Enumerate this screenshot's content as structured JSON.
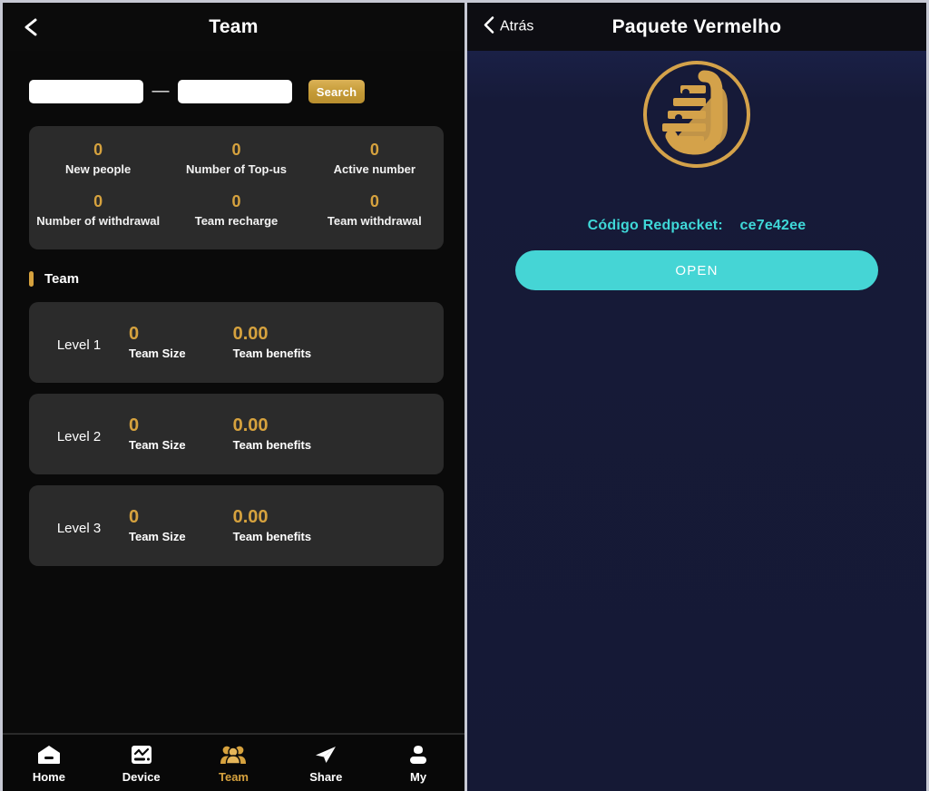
{
  "left": {
    "header": {
      "back_icon": "chevron-left-icon",
      "title": "Team"
    },
    "search": {
      "input_start_value": "",
      "input_start_placeholder": "",
      "separator": "—",
      "input_end_value": "",
      "input_end_placeholder": "",
      "button_label": "Search"
    },
    "stats": [
      {
        "value": "0",
        "label": "New people"
      },
      {
        "value": "0",
        "label": "Number of Top-us"
      },
      {
        "value": "0",
        "label": "Active number"
      },
      {
        "value": "0",
        "label": "Number of withdrawal"
      },
      {
        "value": "0",
        "label": "Team recharge"
      },
      {
        "value": "0",
        "label": "Team withdrawal"
      }
    ],
    "section": {
      "title": "Team"
    },
    "levels": [
      {
        "name": "Level 1",
        "size_value": "0",
        "size_label": "Team Size",
        "benefits_value": "0.00",
        "benefits_label": "Team benefits"
      },
      {
        "name": "Level 2",
        "size_value": "0",
        "size_label": "Team Size",
        "benefits_value": "0.00",
        "benefits_label": "Team benefits"
      },
      {
        "name": "Level 3",
        "size_value": "0",
        "size_label": "Team Size",
        "benefits_value": "0.00",
        "benefits_label": "Team benefits"
      }
    ],
    "nav": [
      {
        "label": "Home",
        "icon": "home-icon",
        "active": false
      },
      {
        "label": "Device",
        "icon": "device-icon",
        "active": false
      },
      {
        "label": "Team",
        "icon": "team-icon",
        "active": true
      },
      {
        "label": "Share",
        "icon": "share-icon",
        "active": false
      },
      {
        "label": "My",
        "icon": "user-icon",
        "active": false
      }
    ]
  },
  "right": {
    "header": {
      "back_icon": "chevron-left-icon",
      "back_label": "Atrás",
      "title": "Paquete Vermelho"
    },
    "logo": {
      "icon": "brand-u-logo-icon"
    },
    "code": {
      "label": "Código Redpacket:",
      "value": "ce7e42ee"
    },
    "open_button": {
      "label": "OPEN"
    }
  },
  "colors": {
    "gold": "#d6a23e",
    "cyan": "#3fd8d8",
    "turquoise": "#45d5d5",
    "card_dark": "#2b2b2b",
    "page_dark": "#0a0a0a",
    "navy": "#161a38"
  }
}
